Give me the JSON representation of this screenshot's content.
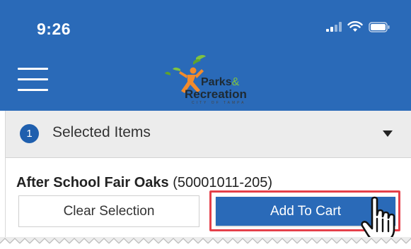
{
  "status_bar": {
    "time": "9:26",
    "icons": [
      "signal-icon",
      "wifi-icon",
      "battery-icon"
    ]
  },
  "header": {
    "menu_icon": "hamburger-menu-icon",
    "logo": {
      "line1": "Parks",
      "ampersand": "&",
      "line2": "Recreation",
      "line3": "CITY OF TAMPA"
    }
  },
  "selected_items": {
    "count": "1",
    "label": "Selected Items",
    "icon": "caret-down-icon"
  },
  "item": {
    "name": "After School Fair Oaks",
    "code": "(50001011-205)"
  },
  "buttons": {
    "clear_label": "Clear Selection",
    "add_to_cart_label": "Add To Cart"
  },
  "colors": {
    "header_blue": "#2a6ab8",
    "badge_blue": "#1f5fae",
    "highlight_red": "#e5404a",
    "bar_gray": "#ececec"
  }
}
